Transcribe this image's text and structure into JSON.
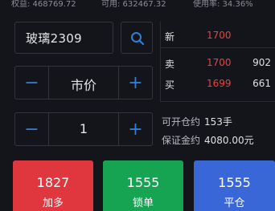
{
  "topbar": {
    "equity": "权益: 468769.72",
    "available": "可用: 632467.32",
    "usage": "使用率: 34.36%"
  },
  "symbol": {
    "name": "玻璃2309"
  },
  "icons": {
    "search": "search-icon",
    "minus": "minus-icon",
    "plus": "plus-icon"
  },
  "price_stepper": {
    "value": "市价",
    "minus": "−",
    "plus": "+"
  },
  "qty_stepper": {
    "value": "1",
    "minus": "−",
    "plus": "+"
  },
  "quote": {
    "last": {
      "label": "新",
      "price": "1700"
    },
    "ask": {
      "label": "卖",
      "price": "1700",
      "volume": "902"
    },
    "bid": {
      "label": "买",
      "price": "1699",
      "volume": "661"
    }
  },
  "info": {
    "openable_label": "可开仓约",
    "openable_value": "153手",
    "margin_label": "保证金约",
    "margin_value": "4080.00元"
  },
  "actions": [
    {
      "price": "1827",
      "label": "加多",
      "color": "#e0363e"
    },
    {
      "price": "1555",
      "label": "锁单",
      "color": "#16a453"
    },
    {
      "price": "1555",
      "label": "平仓",
      "color": "#3a67d8"
    }
  ],
  "colors": {
    "background": "#14151b",
    "accent_blue": "#2f7fd6",
    "price_red": "#e8413f"
  }
}
